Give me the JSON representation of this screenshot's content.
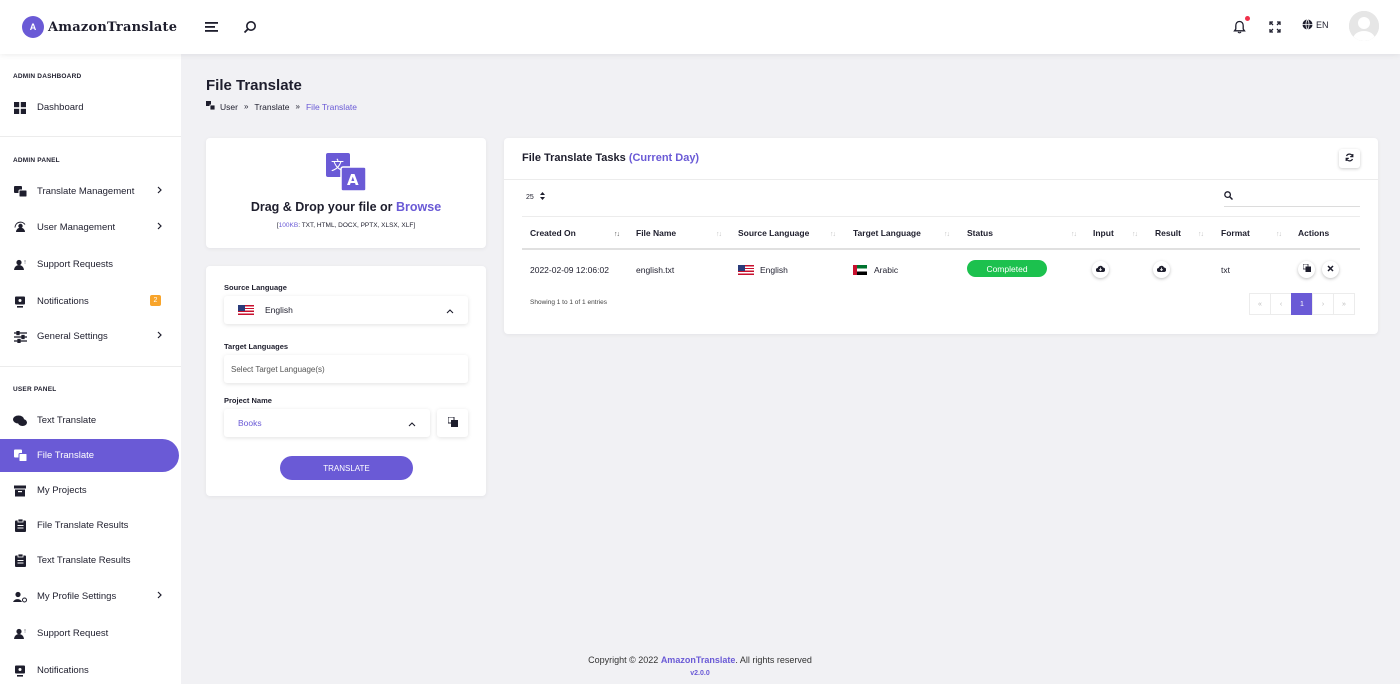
{
  "app": {
    "name": "AmazonTranslate",
    "logo_letter": "A"
  },
  "topbar": {
    "language": "EN"
  },
  "sidebar": {
    "admin_dashboard_heading": "ADMIN DASHBOARD",
    "admin_panel_heading": "ADMIN PANEL",
    "user_panel_heading": "USER PANEL",
    "items": [
      {
        "label": "Dashboard"
      },
      {
        "label": "Translate Management"
      },
      {
        "label": "User Management"
      },
      {
        "label": "Support Requests"
      },
      {
        "label": "Notifications",
        "badge": "2"
      },
      {
        "label": "General Settings"
      },
      {
        "label": "Text Translate"
      },
      {
        "label": "File Translate"
      },
      {
        "label": "My Projects"
      },
      {
        "label": "File Translate Results"
      },
      {
        "label": "Text Translate Results"
      },
      {
        "label": "My Profile Settings"
      },
      {
        "label": "Support Request"
      },
      {
        "label": "Notifications"
      }
    ],
    "active_index": 7
  },
  "page": {
    "title": "File Translate",
    "breadcrumb": [
      "User",
      "Translate",
      "File Translate"
    ]
  },
  "upload": {
    "title_prefix": "Drag & Drop your file or",
    "browse_label": "Browse",
    "size_limit": "100KB",
    "formats": ": TXT, HTML, DOCX, PPTX, XLSX, XLF"
  },
  "form": {
    "source_label": "Source Language",
    "source_value": "English",
    "target_label": "Target Languages",
    "target_placeholder": "Select Target Language(s)",
    "project_label": "Project Name",
    "project_value": "Books",
    "translate_button": "TRANSLATE"
  },
  "tasks": {
    "title": "File Translate Tasks",
    "title_suffix": "(Current Day)",
    "per_page": "25",
    "columns": [
      "Created On",
      "File Name",
      "Source Language",
      "Target Language",
      "Status",
      "Input",
      "Result",
      "Format",
      "Actions"
    ],
    "rows": [
      {
        "created_on": "2022-02-09 12:06:02",
        "file_name": "english.txt",
        "source_language": "English",
        "target_language": "Arabic",
        "status": "Completed",
        "format": "txt"
      }
    ],
    "showing": "Showing 1 to 1 of 1 entries",
    "pagination": {
      "first": "«",
      "prev": "‹",
      "current": "1",
      "next": "›",
      "last": "»"
    }
  },
  "footer": {
    "copyright_prefix": "Copyright © 2022",
    "brand": "AmazonTranslate",
    "copyright_suffix": ". All rights reserved",
    "version": "v2.0.0"
  },
  "colors": {
    "accent": "#6a5ad6",
    "success": "#1cc14e",
    "badge": "#f8a42a"
  }
}
